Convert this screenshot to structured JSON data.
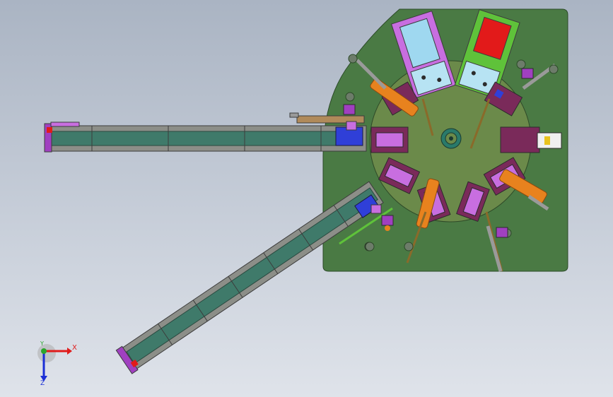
{
  "viewport": {
    "background_top": "#aab4c3",
    "background_bottom": "#dfe3ea"
  },
  "triad": {
    "x_label": "X",
    "y_label": "Y",
    "z_label": "Z",
    "x_color": "#e01b1b",
    "y_color": "#2ba52b",
    "z_color": "#1b2fd6"
  },
  "colors": {
    "base_plate": "#4a7a44",
    "turntable": "#6b8a4a",
    "conveyor_frame": "#8c8e88",
    "conveyor_belt": "#3f7a6a",
    "accent_orange": "#e8821e",
    "accent_purple": "#c86ee0",
    "accent_green": "#5fc23a",
    "accent_red": "#e21a1a",
    "accent_blue": "#2f3fd8",
    "accent_lightblue": "#9fd8f0"
  },
  "model": {
    "components": [
      "base-plate",
      "rotary-turntable",
      "straight-conveyor",
      "angled-conveyor",
      "press-station-purple",
      "press-station-green",
      "stations-ring",
      "center-hub"
    ]
  }
}
